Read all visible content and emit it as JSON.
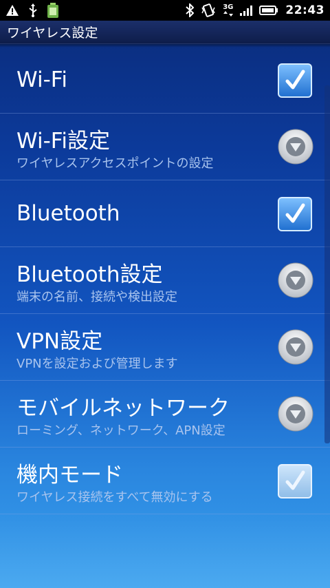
{
  "status_bar": {
    "time": "22:43",
    "network_type": "3G",
    "icons_left": [
      "warning-icon",
      "usb-icon",
      "battery-app-icon"
    ],
    "icons_right": [
      "bluetooth-icon",
      "vibrate-icon",
      "network-3g-icon",
      "signal-icon",
      "battery-icon"
    ]
  },
  "title_bar": {
    "title": "ワイヤレス設定"
  },
  "items": [
    {
      "title": "Wi-Fi",
      "summary": "",
      "widget": "checkbox",
      "checked": true,
      "enabled": true
    },
    {
      "title": "Wi-Fi設定",
      "summary": "ワイヤレスアクセスポイントの設定",
      "widget": "chevron"
    },
    {
      "title": "Bluetooth",
      "summary": "",
      "widget": "checkbox",
      "checked": true,
      "enabled": true
    },
    {
      "title": "Bluetooth設定",
      "summary": "端末の名前、接続や検出設定",
      "widget": "chevron"
    },
    {
      "title": "VPN設定",
      "summary": "VPNを設定および管理します",
      "widget": "chevron"
    },
    {
      "title": "モバイルネットワーク",
      "summary": "ローミング、ネットワーク、APN設定",
      "widget": "chevron"
    },
    {
      "title": "機内モード",
      "summary": "ワイヤレス接続をすべて無効にする",
      "widget": "checkbox",
      "checked": true,
      "enabled": false
    }
  ],
  "colors": {
    "checkbox_active": "#2f86e0",
    "checkbox_disabled": "#9cc6ee",
    "summary_text": "#a9c4ee"
  }
}
